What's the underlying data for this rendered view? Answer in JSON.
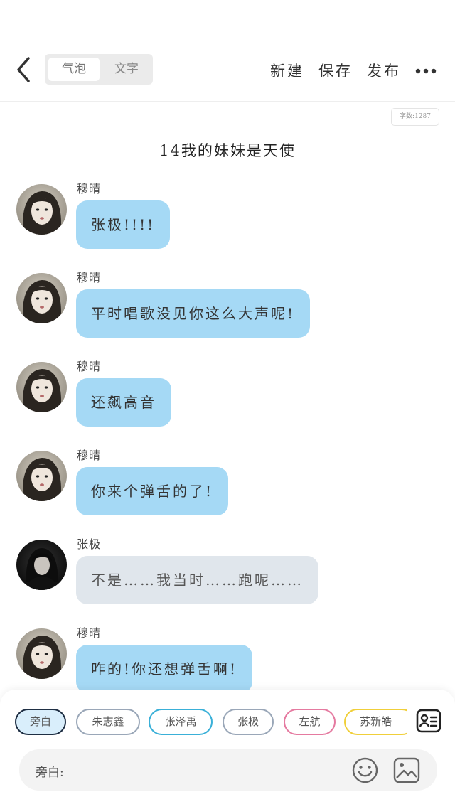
{
  "topbar": {
    "segments": [
      "气泡",
      "文字"
    ],
    "actions": [
      "新建",
      "保存",
      "发布"
    ]
  },
  "word_count": "字数:1287",
  "title": "14我的妹妹是天使",
  "messages": [
    {
      "name": "穆晴",
      "text": "张极!!!!",
      "style": "blue",
      "avatar": "girl-avatar"
    },
    {
      "name": "穆晴",
      "text": "平时唱歌没见你这么大声呢!",
      "style": "blue",
      "avatar": "girl-avatar"
    },
    {
      "name": "穆晴",
      "text": "还飙高音",
      "style": "blue",
      "avatar": "girl-avatar"
    },
    {
      "name": "穆晴",
      "text": "你来个弹舌的了!",
      "style": "blue",
      "avatar": "girl-avatar"
    },
    {
      "name": "张极",
      "text": "不是……我当时……跑呢……",
      "style": "grey",
      "avatar": "boy-avatar"
    },
    {
      "name": "穆晴",
      "text": "咋的!你还想弹舌啊!",
      "style": "blue",
      "avatar": "girl-avatar"
    }
  ],
  "characters": [
    {
      "label": "旁白",
      "color": "#1f2f44",
      "selected": true
    },
    {
      "label": "朱志鑫",
      "color": "#9aa7b8",
      "selected": false
    },
    {
      "label": "张泽禹",
      "color": "#3ab0d8",
      "selected": false
    },
    {
      "label": "张极",
      "color": "#9aa7b8",
      "selected": false
    },
    {
      "label": "左航",
      "color": "#e57aa0",
      "selected": false
    },
    {
      "label": "苏新皓",
      "color": "#f0cf3a",
      "selected": false
    }
  ],
  "input": {
    "label": "旁白:"
  },
  "colors": {
    "bubble_blue": "#a5d9f5",
    "bubble_grey": "#e0e6ec"
  }
}
